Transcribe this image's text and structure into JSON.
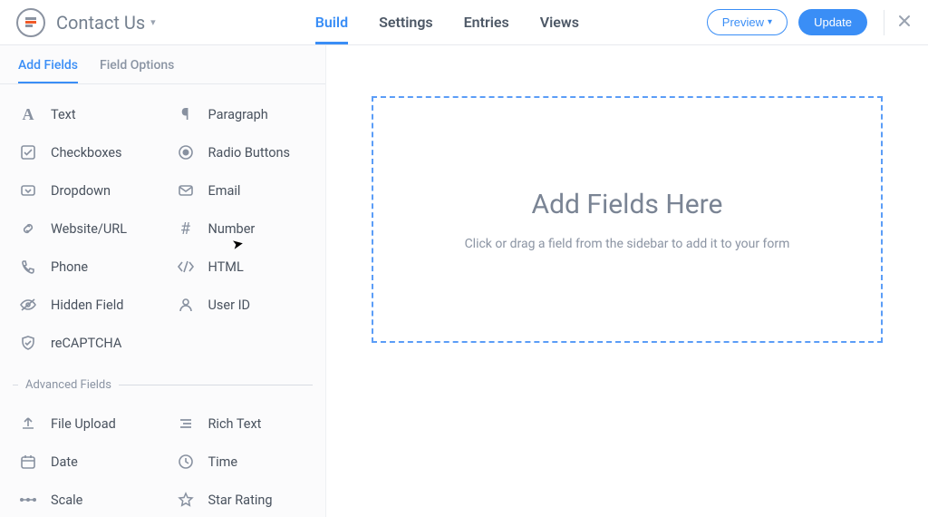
{
  "header": {
    "form_title": "Contact Us",
    "tabs": [
      "Build",
      "Settings",
      "Entries",
      "Views"
    ],
    "active_tab": 0,
    "preview_label": "Preview",
    "update_label": "Update"
  },
  "sidebar": {
    "subtabs": [
      "Add Fields",
      "Field Options"
    ],
    "active_subtab": 0,
    "basic_fields": [
      {
        "label": "Text",
        "icon": "text-icon"
      },
      {
        "label": "Paragraph",
        "icon": "paragraph-icon"
      },
      {
        "label": "Checkboxes",
        "icon": "checkbox-icon"
      },
      {
        "label": "Radio Buttons",
        "icon": "radio-icon"
      },
      {
        "label": "Dropdown",
        "icon": "dropdown-icon"
      },
      {
        "label": "Email",
        "icon": "email-icon"
      },
      {
        "label": "Website/URL",
        "icon": "link-icon"
      },
      {
        "label": "Number",
        "icon": "hash-icon"
      },
      {
        "label": "Phone",
        "icon": "phone-icon"
      },
      {
        "label": "HTML",
        "icon": "code-icon"
      },
      {
        "label": "Hidden Field",
        "icon": "hidden-icon"
      },
      {
        "label": "User ID",
        "icon": "user-icon"
      },
      {
        "label": "reCAPTCHA",
        "icon": "shield-icon"
      }
    ],
    "section_label": "Advanced Fields",
    "advanced_fields": [
      {
        "label": "File Upload",
        "icon": "upload-icon"
      },
      {
        "label": "Rich Text",
        "icon": "richtext-icon"
      },
      {
        "label": "Date",
        "icon": "calendar-icon"
      },
      {
        "label": "Time",
        "icon": "clock-icon"
      },
      {
        "label": "Scale",
        "icon": "scale-icon"
      },
      {
        "label": "Star Rating",
        "icon": "star-icon"
      }
    ]
  },
  "canvas": {
    "title": "Add Fields Here",
    "subtitle": "Click or drag a field from the sidebar to add it to your form"
  },
  "colors": {
    "accent": "#3a8ef6",
    "muted": "#8b94a3"
  }
}
